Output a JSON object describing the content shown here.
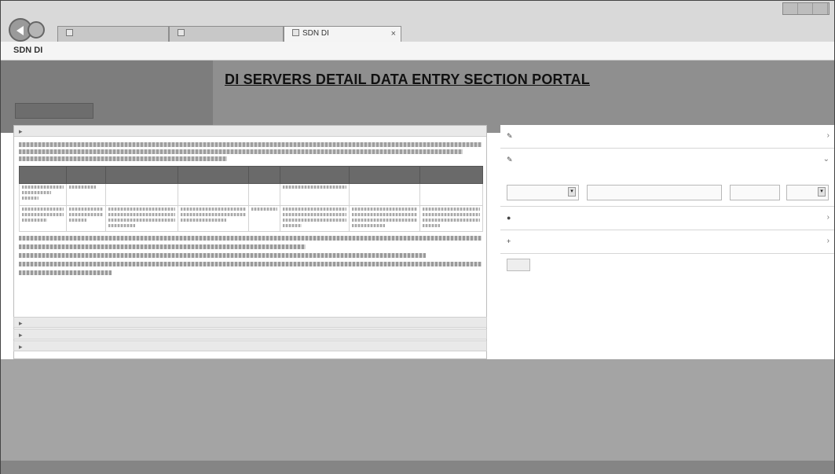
{
  "browser": {
    "tabs": [
      {
        "label": ""
      },
      {
        "label": ""
      },
      {
        "label": "SDN DI"
      }
    ]
  },
  "app": {
    "title": "SDN DI",
    "top_links": ""
  },
  "header": {
    "page_heading": "",
    "main_title": "DI SERVERS DETAIL DATA ENTRY SECTION PORTAL",
    "button_label": ""
  },
  "left_panel": {
    "section_title": "",
    "intro_lines": 3,
    "table": {
      "headers": [
        "",
        "",
        "",
        "",
        "",
        "",
        "",
        "",
        ""
      ],
      "rows": [
        [
          "",
          "",
          "",
          "",
          "",
          "",
          "",
          "",
          ""
        ],
        [
          "",
          "",
          "",
          "",
          "",
          "",
          "",
          "",
          ""
        ]
      ]
    },
    "notes": [
      "",
      "",
      ""
    ],
    "collapsed_sections": [
      "",
      "",
      ""
    ]
  },
  "right_panel": {
    "sections": [
      {
        "title": "",
        "icon": "server-icon"
      },
      {
        "title": "",
        "icon": "edit-icon"
      }
    ],
    "form": {
      "network_type_label": "",
      "server_ip_label": "",
      "port_label": "",
      "action_label": ""
    },
    "lower_sections": [
      {
        "title": "",
        "icon": "user-icon"
      },
      {
        "title": "",
        "icon": "plus-icon"
      }
    ],
    "add_button": ""
  }
}
